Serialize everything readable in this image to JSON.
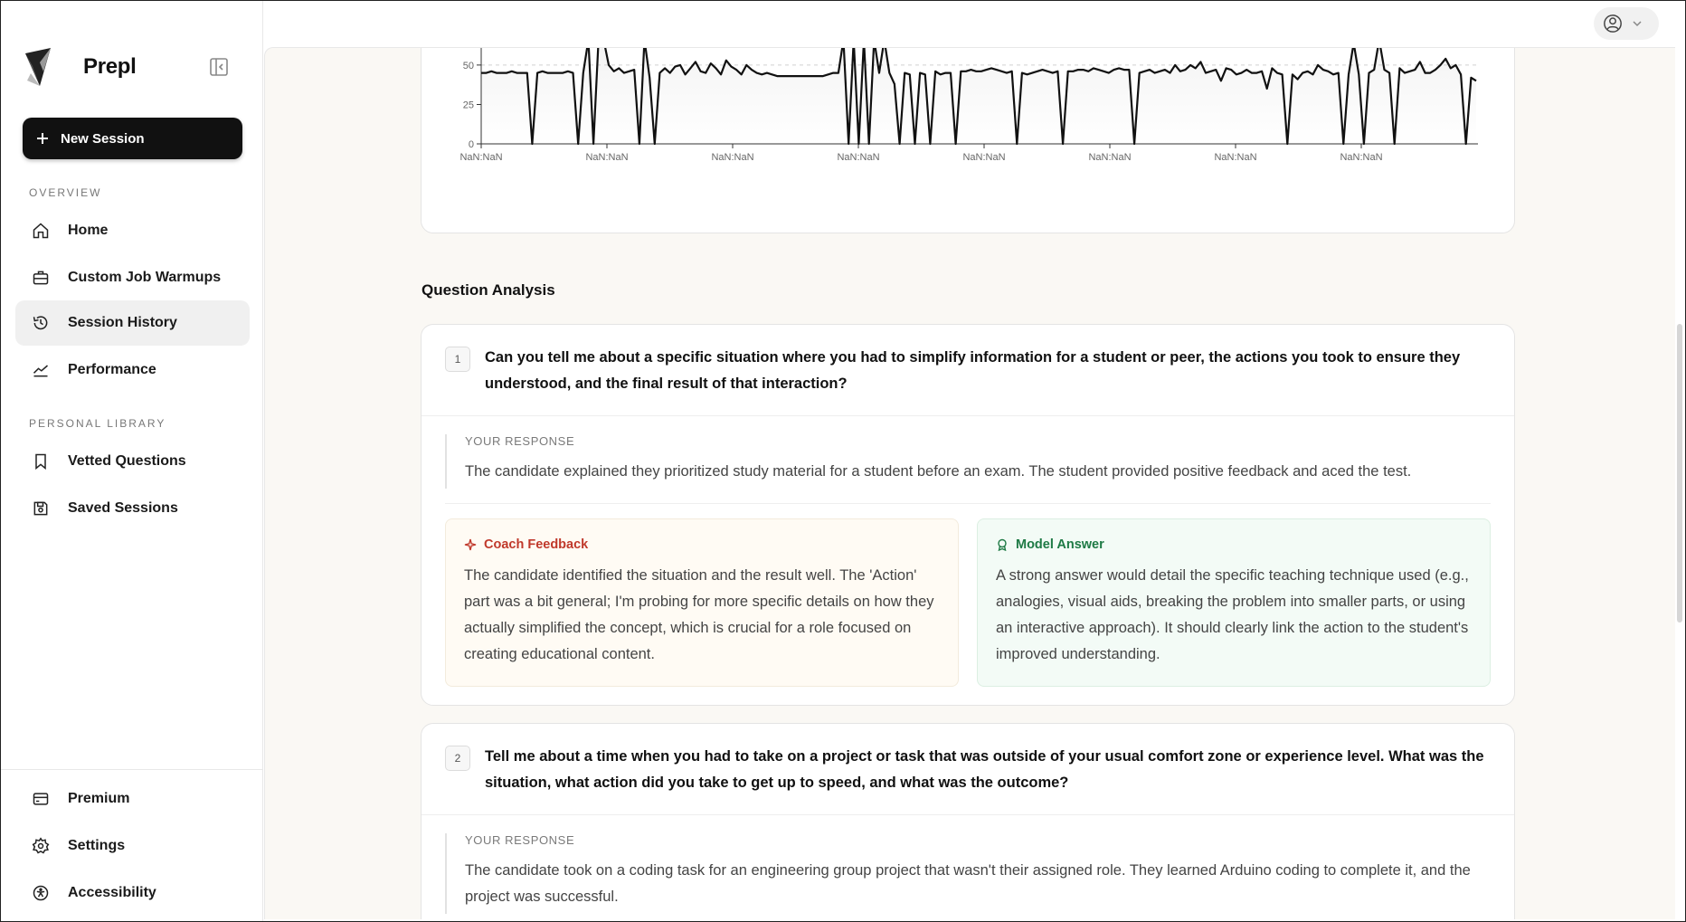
{
  "app": {
    "name": "Prepl"
  },
  "sidebar": {
    "new_session": "New Session",
    "overview_label": "OVERVIEW",
    "overview_items": [
      {
        "label": "Home"
      },
      {
        "label": "Custom Job Warmups"
      },
      {
        "label": "Session History"
      },
      {
        "label": "Performance"
      }
    ],
    "library_label": "PERSONAL LIBRARY",
    "library_items": [
      {
        "label": "Vetted Questions"
      },
      {
        "label": "Saved Sessions"
      }
    ],
    "bottom_items": [
      {
        "label": "Premium"
      },
      {
        "label": "Settings"
      },
      {
        "label": "Accessibility"
      }
    ],
    "active_item": "Session History"
  },
  "chart_data": {
    "type": "line",
    "y_ticks": [
      "0",
      "25",
      "50"
    ],
    "x_ticks": [
      "NaN:NaN",
      "NaN:NaN",
      "NaN:NaN",
      "NaN:NaN",
      "NaN:NaN",
      "NaN:NaN",
      "NaN:NaN",
      "NaN:NaN"
    ],
    "ylim": [
      0,
      66
    ],
    "reference_line": 50,
    "series": [
      {
        "values": [
          45,
          45,
          46,
          45,
          45,
          45,
          46,
          45,
          45,
          45,
          0,
          45,
          46,
          45,
          45,
          45,
          45,
          46,
          45,
          0,
          45,
          66,
          0,
          66,
          66,
          50,
          46,
          48,
          45,
          46,
          47,
          0,
          66,
          42,
          0,
          45,
          48,
          45,
          49,
          50,
          44,
          48,
          52,
          46,
          45,
          51,
          48,
          44,
          53,
          49,
          47,
          44,
          50,
          47,
          45,
          44,
          45,
          44,
          43,
          43,
          43,
          43,
          43,
          43,
          43,
          43,
          43,
          43,
          44,
          45,
          45,
          66,
          0,
          66,
          0,
          66,
          0,
          66,
          45,
          66,
          45,
          38,
          0,
          45,
          44,
          0,
          45,
          44,
          0,
          46,
          44,
          45,
          45,
          0,
          46,
          46,
          47,
          46,
          46,
          47,
          48,
          47,
          46,
          45,
          46,
          0,
          45,
          44,
          45,
          46,
          47,
          46,
          45,
          46,
          0,
          46,
          46,
          47,
          47,
          46,
          48,
          47,
          46,
          45,
          47,
          48,
          47,
          47,
          0,
          45,
          46,
          47,
          45,
          46,
          47,
          45,
          50,
          46,
          47,
          50,
          48,
          52,
          45,
          46,
          47,
          40,
          48,
          47,
          44,
          45,
          47,
          45,
          45,
          46,
          35,
          48,
          45,
          44,
          0,
          44,
          41,
          45,
          46,
          44,
          50,
          47,
          46,
          44,
          45,
          0,
          44,
          64,
          44,
          0,
          45,
          47,
          66,
          47,
          45,
          0,
          48,
          45,
          46,
          47,
          52,
          45,
          45,
          47,
          50,
          54,
          48,
          50,
          44,
          0,
          42,
          40
        ]
      }
    ]
  },
  "question_analysis": {
    "title": "Question Analysis",
    "response_label": "YOUR RESPONSE",
    "coach_label": "Coach Feedback",
    "model_label": "Model Answer",
    "questions": [
      {
        "number": "1",
        "question": "Can you tell me about a specific situation where you had to simplify information for a student or peer, the actions you took to ensure they understood, and the final result of that interaction?",
        "response": "The candidate explained they prioritized study material for a student before an exam. The student provided positive feedback and aced the test.",
        "coach_feedback": "The candidate identified the situation and the result well. The 'Action' part was a bit general; I'm probing for more specific details on how they actually simplified the concept, which is crucial for a role focused on creating educational content.",
        "model_answer": "A strong answer would detail the specific teaching technique used (e.g., analogies, visual aids, breaking the problem into smaller parts, or using an interactive approach). It should clearly link the action to the student's improved understanding."
      },
      {
        "number": "2",
        "question": "Tell me about a time when you had to take on a project or task that was outside of your usual comfort zone or experience level. What was the situation, what action did you take to get up to speed, and what was the outcome?",
        "response": "The candidate took on a coding task for an engineering group project that wasn't their assigned role. They learned Arduino coding to complete it, and the project was successful."
      }
    ]
  }
}
